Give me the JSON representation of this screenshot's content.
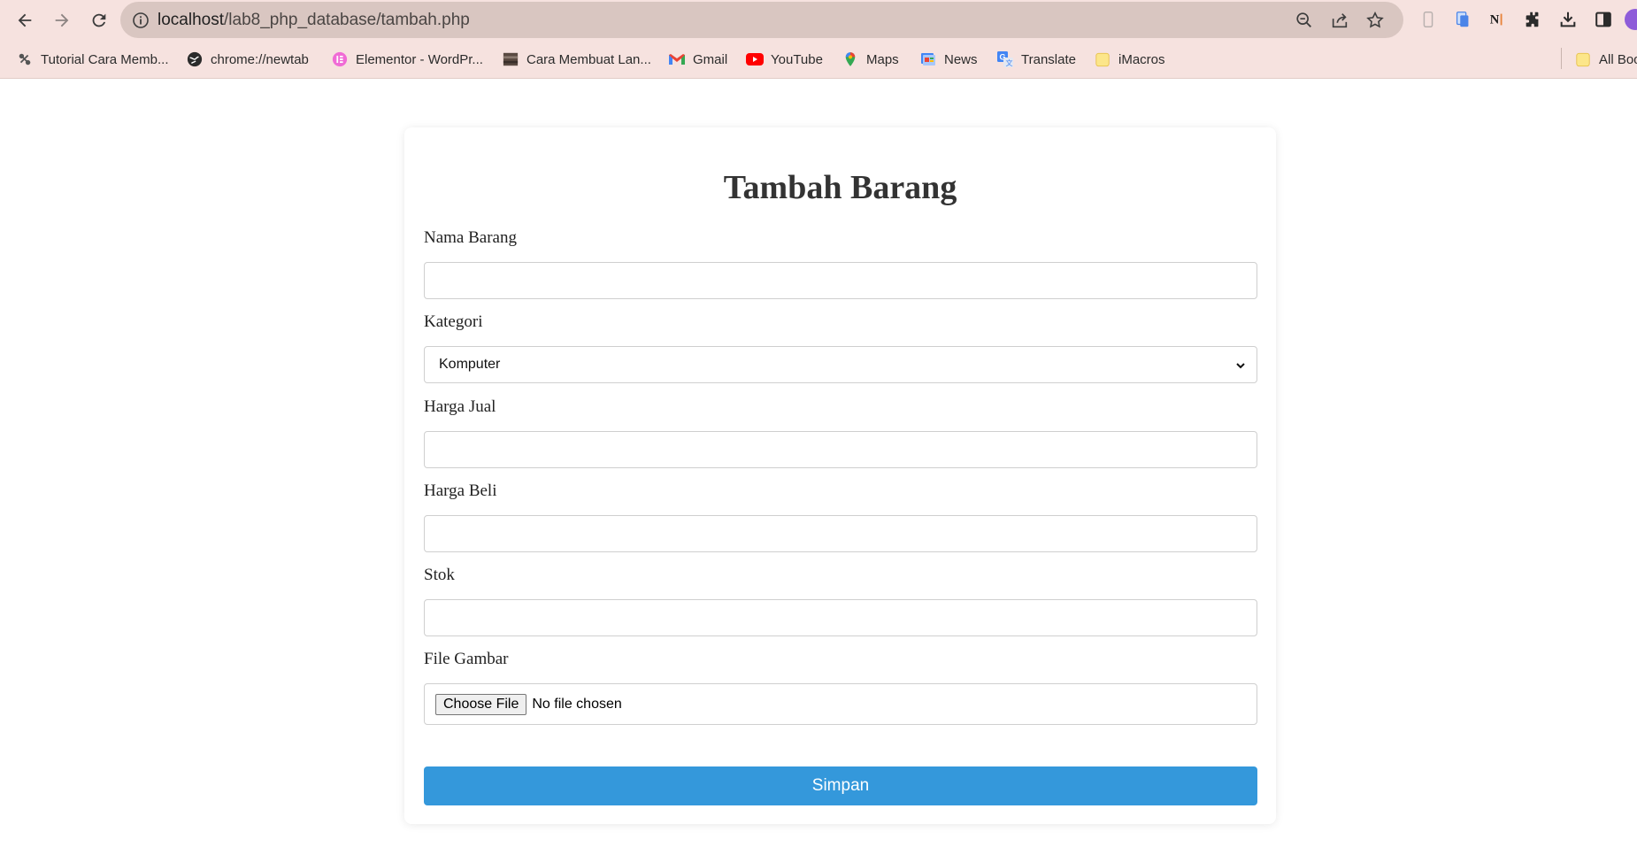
{
  "browser": {
    "url_host": "localhost",
    "url_path": "/lab8_php_database/tambah.php",
    "bookmarks": [
      {
        "label": "Tutorial Cara Memb...",
        "icon": "tool-icon"
      },
      {
        "label": "chrome://newtab",
        "icon": "globe-icon"
      },
      {
        "label": "Elementor - WordPr...",
        "icon": "elementor-icon"
      },
      {
        "label": "Cara Membuat Lan...",
        "icon": "thumbnail-icon"
      },
      {
        "label": "Gmail",
        "icon": "gmail-icon"
      },
      {
        "label": "YouTube",
        "icon": "youtube-icon"
      },
      {
        "label": "Maps",
        "icon": "maps-icon"
      },
      {
        "label": "News",
        "icon": "news-icon"
      },
      {
        "label": "Translate",
        "icon": "translate-icon"
      },
      {
        "label": "iMacros",
        "icon": "folder-icon"
      }
    ],
    "all_bookmarks_label": "All Boo"
  },
  "form": {
    "title": "Tambah Barang",
    "fields": [
      {
        "label": "Nama Barang",
        "value": ""
      },
      {
        "label": "Kategori",
        "value": "Komputer"
      },
      {
        "label": "Harga Jual",
        "value": ""
      },
      {
        "label": "Harga Beli",
        "value": ""
      },
      {
        "label": "Stok",
        "value": ""
      },
      {
        "label": "File Gambar",
        "button_label": "Choose File",
        "status": "No file chosen"
      }
    ],
    "submit_label": "Simpan"
  },
  "colors": {
    "browser_frame": "#f6e2df",
    "omnibox": "#d9c6c1",
    "submit_button": "#3498db",
    "title_text": "#333333"
  }
}
